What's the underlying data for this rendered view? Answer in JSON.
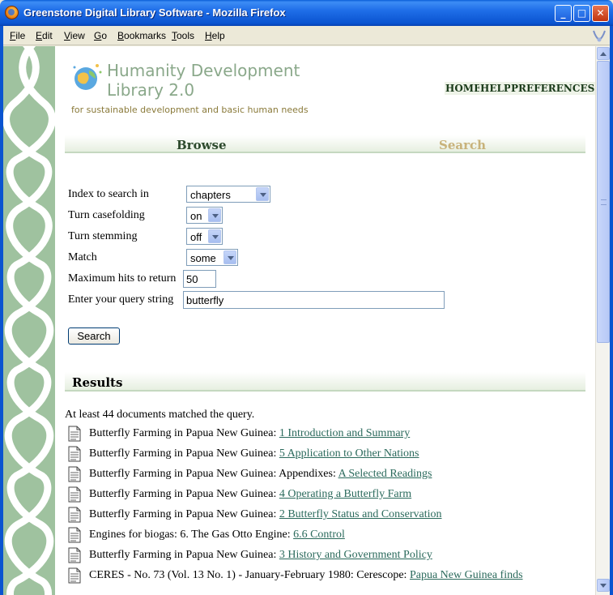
{
  "window": {
    "title": "Greenstone Digital Library Software - Mozilla Firefox",
    "minimize": "_",
    "maximize": "□",
    "close": "✕"
  },
  "menu": [
    "File",
    "Edit",
    "View",
    "Go",
    "Bookmarks",
    "Tools",
    "Help"
  ],
  "header": {
    "title_line1": "Humanity Development",
    "title_line2": "Library 2.0",
    "subtitle": "for sustainable development and basic human needs",
    "links": {
      "home": "HOME",
      "help": "HELP",
      "preferences": "PREFERENCES"
    }
  },
  "nav": {
    "browse": "Browse",
    "search": "Search"
  },
  "form": {
    "index_label": "Index to search in",
    "index_value": "chapters",
    "casefold_label": "Turn casefolding",
    "casefold_value": "on",
    "stemming_label": "Turn stemming",
    "stemming_value": "off",
    "match_label": "Match",
    "match_value": "some",
    "maxhits_label": "Maximum hits to return",
    "maxhits_value": "50",
    "query_label": "Enter your query string",
    "query_value": "butterfly",
    "search_button": "Search"
  },
  "results": {
    "heading": "Results",
    "summary": "At least 44 documents matched the query.",
    "items": [
      {
        "prefix": "Butterfly Farming in Papua New Guinea: ",
        "link": "1 Introduction and Summary"
      },
      {
        "prefix": "Butterfly Farming in Papua New Guinea: ",
        "link": "5 Application to Other Nations"
      },
      {
        "prefix": "Butterfly Farming in Papua New Guinea: Appendixes: ",
        "link": "A Selected Readings"
      },
      {
        "prefix": "Butterfly Farming in Papua New Guinea: ",
        "link": "4 Operating a Butterfly Farm"
      },
      {
        "prefix": "Butterfly Farming in Papua New Guinea: ",
        "link": "2 Butterfly Status and Conservation"
      },
      {
        "prefix": "Engines for biogas: 6. The Gas Otto Engine: ",
        "link": "6.6 Control"
      },
      {
        "prefix": "Butterfly Farming in Papua New Guinea: ",
        "link": "3 History and Government Policy"
      },
      {
        "prefix": "CERES - No. 73 (Vol. 13 No. 1) - January-February 1980: Cerescope: ",
        "link": "Papua New Guinea finds"
      }
    ]
  },
  "colors": {
    "titlebar": "#0a54d0",
    "braid": "#9fc29f",
    "link": "#2b6a5c",
    "nav_active": "#2d4a2d",
    "nav_inactive": "#c8b27a",
    "logo_text": "#8aa88a"
  },
  "icons": [
    "firefox-logo-icon",
    "globe-logo-icon",
    "document-icon",
    "throbber-icon"
  ]
}
